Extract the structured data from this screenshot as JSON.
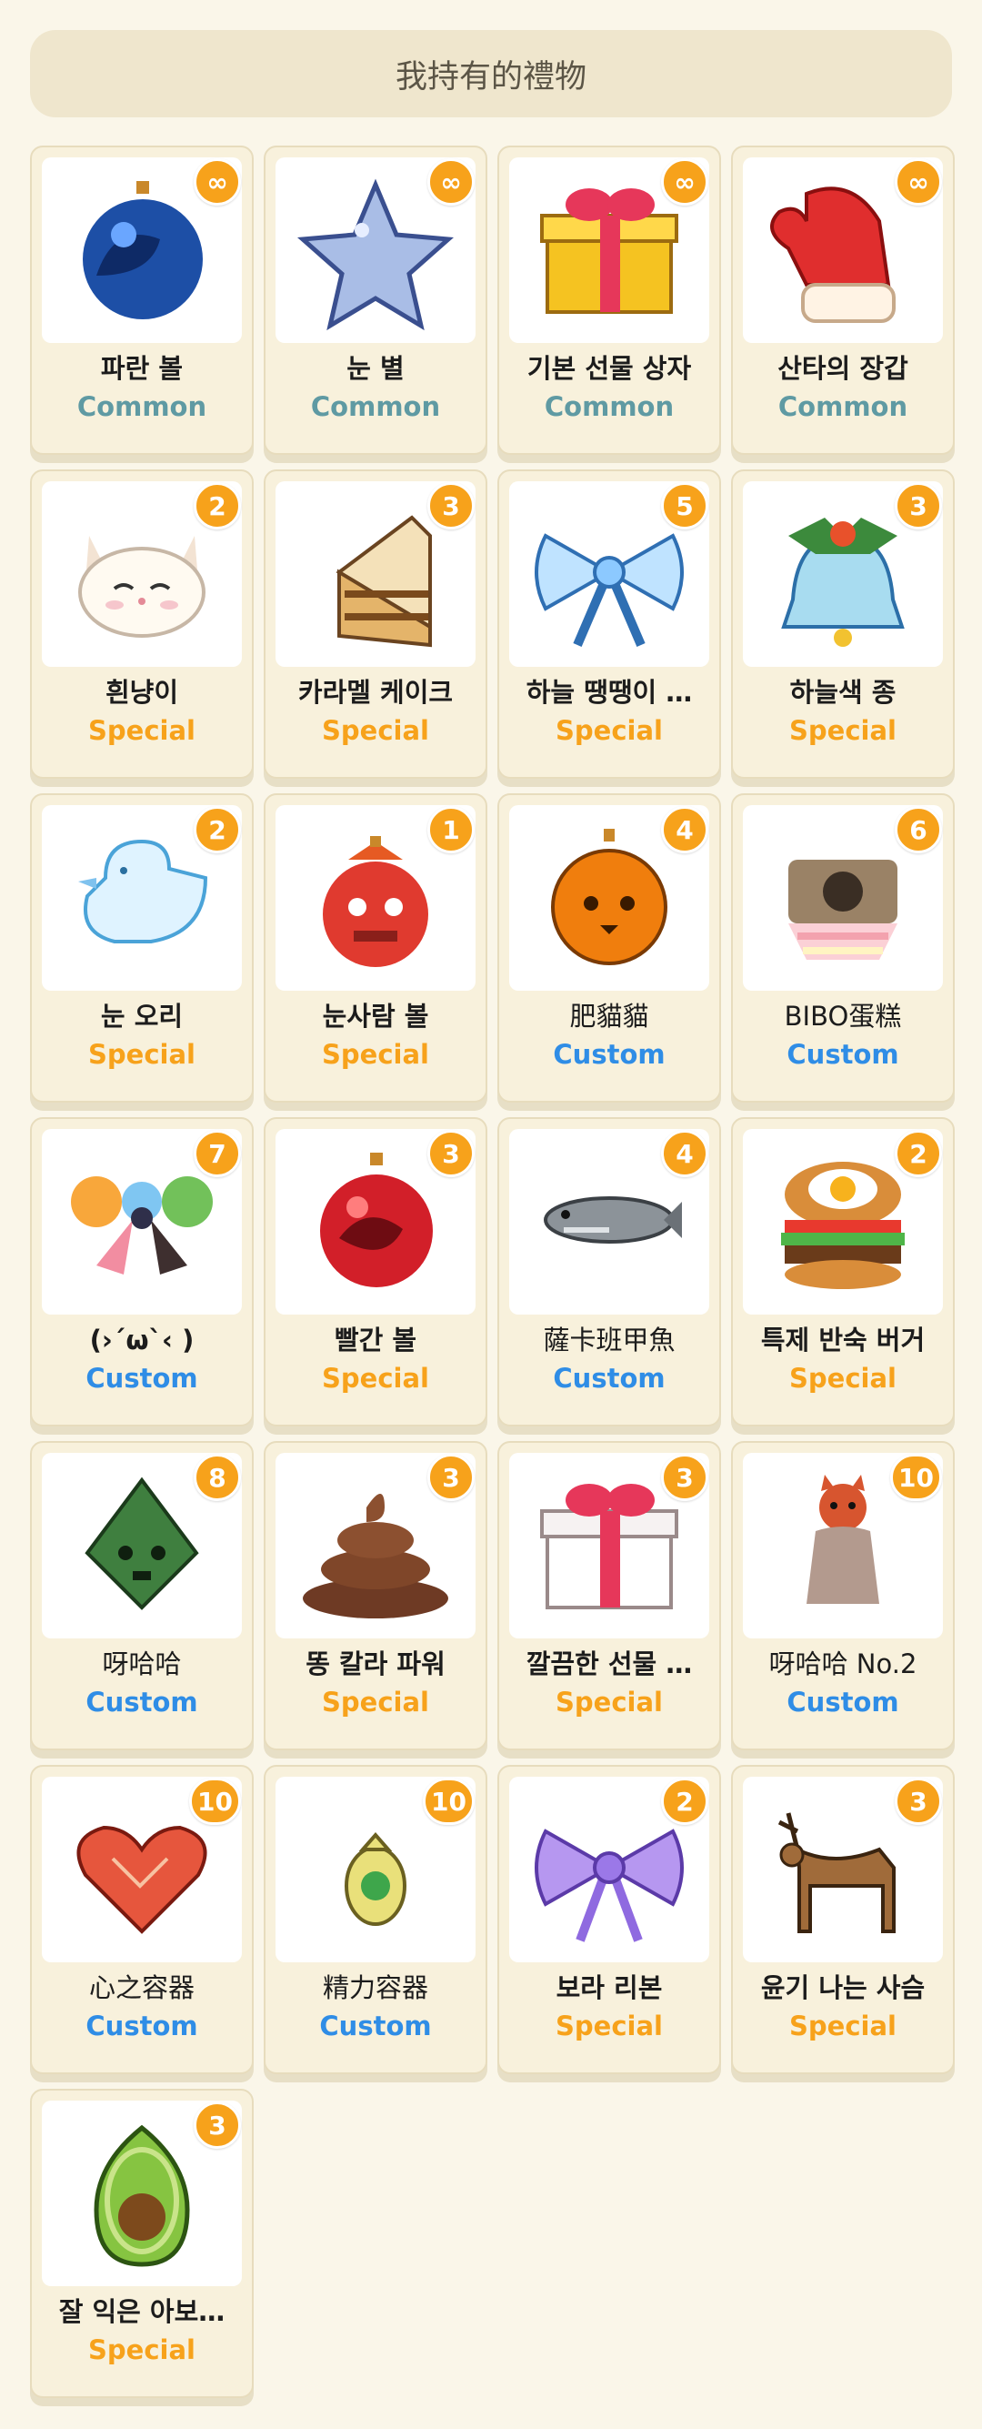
{
  "header": {
    "title": "我持有的禮物"
  },
  "colors": {
    "common": "#5f9aa3",
    "special": "#f7a21b",
    "custom": "#2f8de6",
    "badge": "#f7a21b"
  },
  "gifts": [
    {
      "name": "파란 볼",
      "rarity": "Common",
      "count": "∞",
      "icon": "blue-ornament-icon"
    },
    {
      "name": "눈 별",
      "rarity": "Common",
      "count": "∞",
      "icon": "snow-star-icon"
    },
    {
      "name": "기본 선물 상자",
      "rarity": "Common",
      "count": "∞",
      "icon": "yellow-gift-box-icon"
    },
    {
      "name": "산타의 장갑",
      "rarity": "Common",
      "count": "∞",
      "icon": "red-mitten-icon"
    },
    {
      "name": "흰냥이",
      "rarity": "Special",
      "count": "2",
      "icon": "white-cat-icon"
    },
    {
      "name": "카라멜 케이크",
      "rarity": "Special",
      "count": "3",
      "icon": "caramel-cake-icon"
    },
    {
      "name": "하늘 땡땡이 …",
      "rarity": "Special",
      "count": "5",
      "icon": "sky-polka-bow-icon"
    },
    {
      "name": "하늘색 종",
      "rarity": "Special",
      "count": "3",
      "icon": "sky-bell-icon"
    },
    {
      "name": "눈 오리",
      "rarity": "Special",
      "count": "2",
      "icon": "snow-duck-icon"
    },
    {
      "name": "눈사람 볼",
      "rarity": "Special",
      "count": "1",
      "icon": "snowman-ball-icon"
    },
    {
      "name": "肥貓貓",
      "rarity": "Custom",
      "count": "4",
      "icon": "orange-cat-ornament-icon"
    },
    {
      "name": "BIBO蛋糕",
      "rarity": "Custom",
      "count": "6",
      "icon": "bibo-cake-icon"
    },
    {
      "name": "(›´ω`‹ )",
      "rarity": "Custom",
      "count": "7",
      "icon": "balloon-bow-icon"
    },
    {
      "name": "빨간 볼",
      "rarity": "Special",
      "count": "3",
      "icon": "red-ornament-icon"
    },
    {
      "name": "薩卡班甲魚",
      "rarity": "Custom",
      "count": "4",
      "icon": "fish-icon"
    },
    {
      "name": "특제 반숙 버거",
      "rarity": "Special",
      "count": "2",
      "icon": "burger-icon"
    },
    {
      "name": "呀哈哈",
      "rarity": "Custom",
      "count": "8",
      "icon": "korok-icon"
    },
    {
      "name": "똥 칼라 파워",
      "rarity": "Special",
      "count": "3",
      "icon": "poop-icon"
    },
    {
      "name": "깔끔한 선물 …",
      "rarity": "Special",
      "count": "3",
      "icon": "white-gift-box-icon"
    },
    {
      "name": "呀哈哈 No.2",
      "rarity": "Custom",
      "count": "10",
      "icon": "mask-figure-icon"
    },
    {
      "name": "心之容器",
      "rarity": "Custom",
      "count": "10",
      "icon": "heart-container-icon"
    },
    {
      "name": "精力容器",
      "rarity": "Custom",
      "count": "10",
      "icon": "stamina-vessel-icon"
    },
    {
      "name": "보라 리본",
      "rarity": "Special",
      "count": "2",
      "icon": "purple-ribbon-icon"
    },
    {
      "name": "윤기 나는 사슴",
      "rarity": "Special",
      "count": "3",
      "icon": "deer-icon"
    },
    {
      "name": "잘 익은 아보…",
      "rarity": "Special",
      "count": "3",
      "icon": "avocado-icon"
    }
  ]
}
